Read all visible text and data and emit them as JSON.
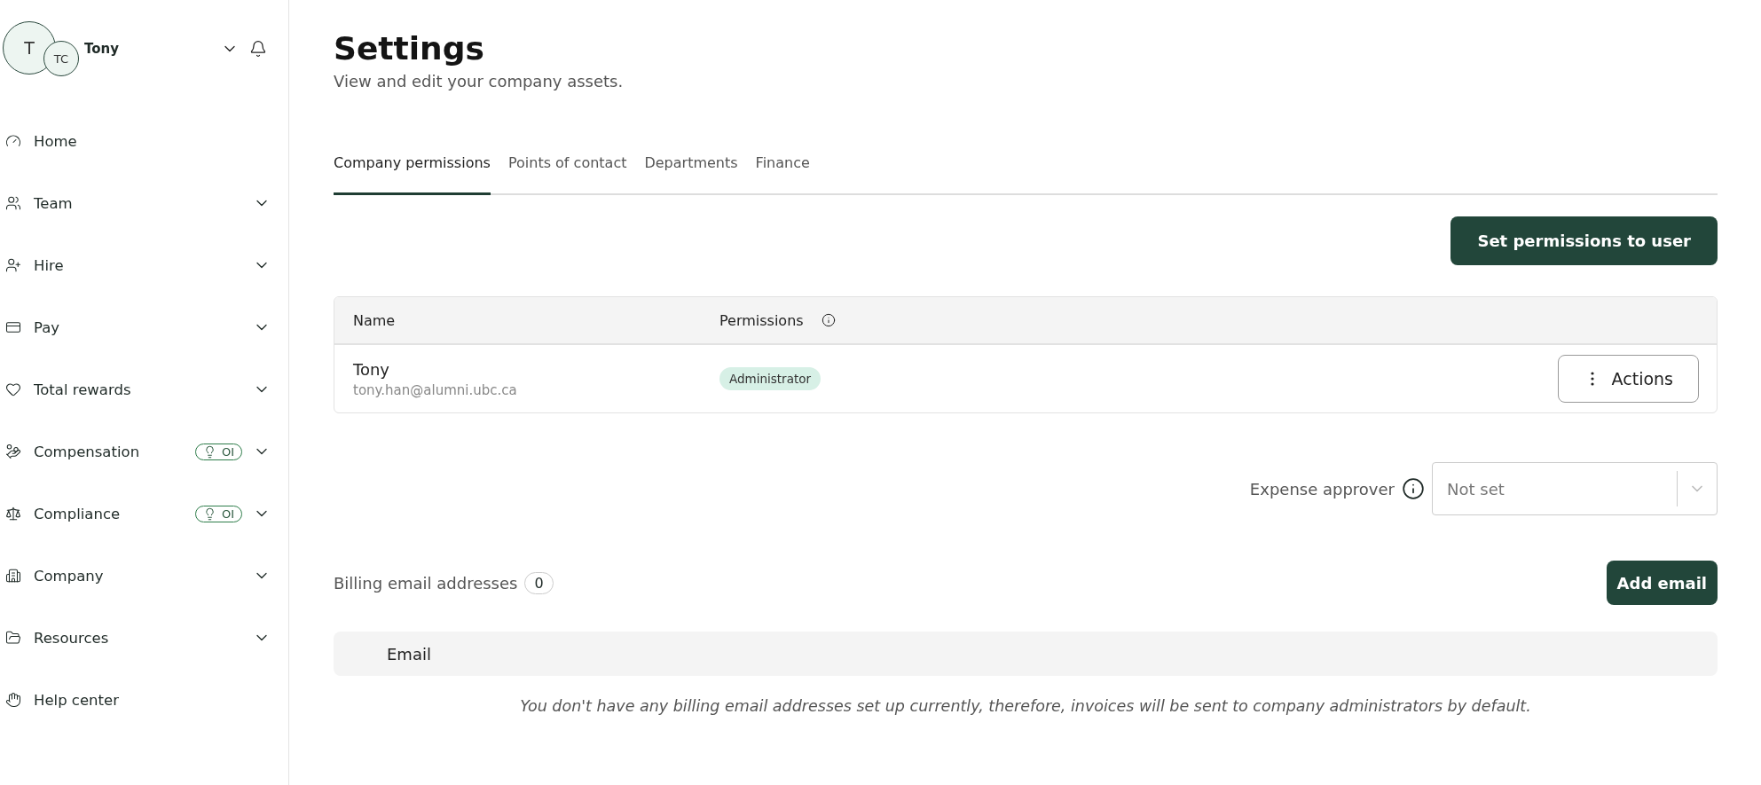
{
  "user": {
    "avatar_initial": "T",
    "company_initials": "TC",
    "name": "Tony"
  },
  "sidebar": {
    "items": [
      {
        "kind": "home",
        "label": "Home",
        "expandable": false
      },
      {
        "kind": "team",
        "label": "Team",
        "expandable": true
      },
      {
        "kind": "hire",
        "label": "Hire",
        "expandable": true
      },
      {
        "kind": "pay",
        "label": "Pay",
        "expandable": true
      },
      {
        "kind": "rewards",
        "label": "Total rewards",
        "expandable": true
      },
      {
        "kind": "compensation",
        "label": "Compensation",
        "expandable": true,
        "badge": "OI"
      },
      {
        "kind": "compliance",
        "label": "Compliance",
        "expandable": true,
        "badge": "OI"
      },
      {
        "kind": "company",
        "label": "Company",
        "expandable": true
      },
      {
        "kind": "resources",
        "label": "Resources",
        "expandable": true
      },
      {
        "kind": "help",
        "label": "Help center",
        "expandable": false
      }
    ]
  },
  "page": {
    "title": "Settings",
    "subtitle": "View and edit your company assets."
  },
  "tabs": [
    {
      "label": "Company permissions",
      "selected": true
    },
    {
      "label": "Points of contact",
      "selected": false
    },
    {
      "label": "Departments",
      "selected": false
    },
    {
      "label": "Finance",
      "selected": false
    }
  ],
  "set_permissions_button": "Set permissions to user",
  "permissions_table": {
    "columns": [
      "Name",
      "Permissions"
    ],
    "rows": [
      {
        "name": "Tony",
        "email": "tony.han@alumni.ubc.ca",
        "role": "Administrator",
        "action": "Actions"
      }
    ]
  },
  "expense_approver": {
    "label": "Expense approver",
    "placeholder": "Not set"
  },
  "billing": {
    "label": "Billing email addresses",
    "count": "0",
    "add_button": "Add email",
    "column": "Email",
    "empty_message": "You don't have any billing email addresses set up currently, therefore, invoices will be sent to company administrators by default."
  }
}
